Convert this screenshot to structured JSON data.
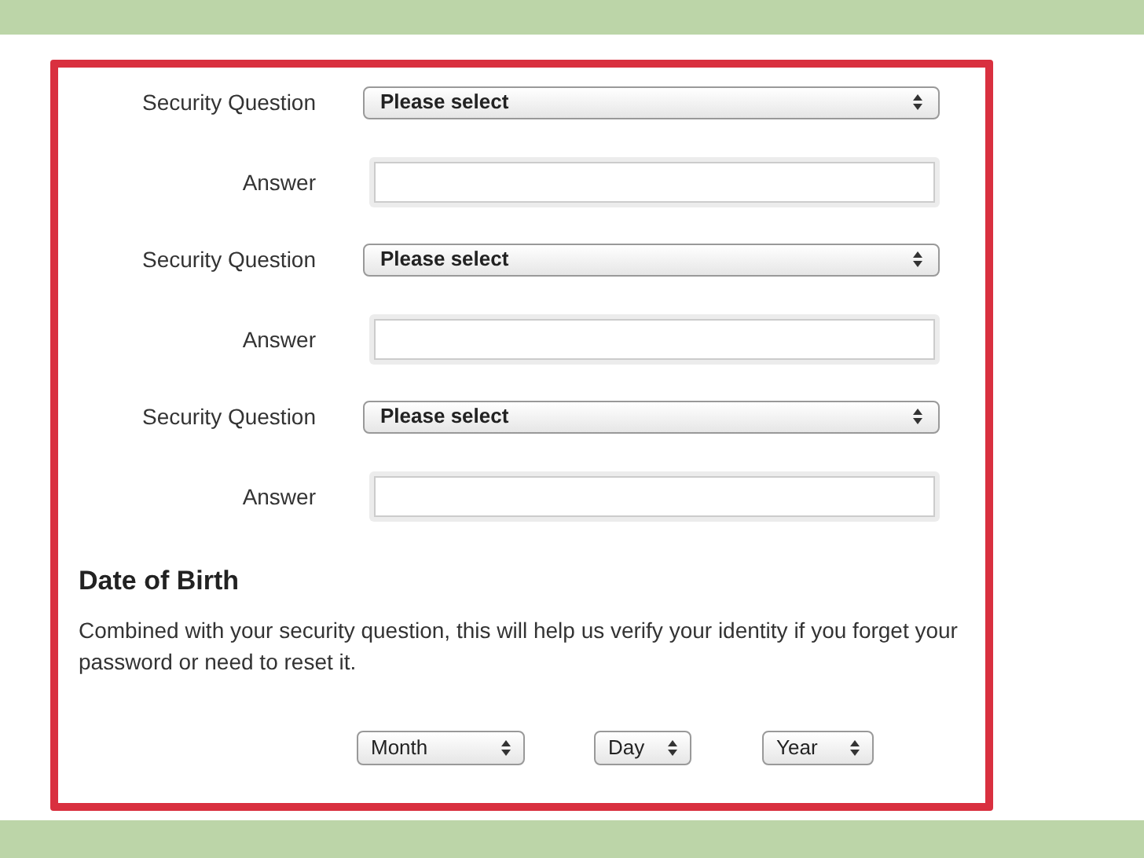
{
  "questions": [
    {
      "label": "Security Question",
      "select": "Please select",
      "answer_label": "Answer"
    },
    {
      "label": "Security Question",
      "select": "Please select",
      "answer_label": "Answer"
    },
    {
      "label": "Security Question",
      "select": "Please select",
      "answer_label": "Answer"
    }
  ],
  "date_of_birth": {
    "heading": "Date of Birth",
    "description": "Combined with your security question, this will help us verify your identity if you forget your password or need to reset it.",
    "selects": [
      "Month",
      "Day",
      "Year"
    ]
  }
}
